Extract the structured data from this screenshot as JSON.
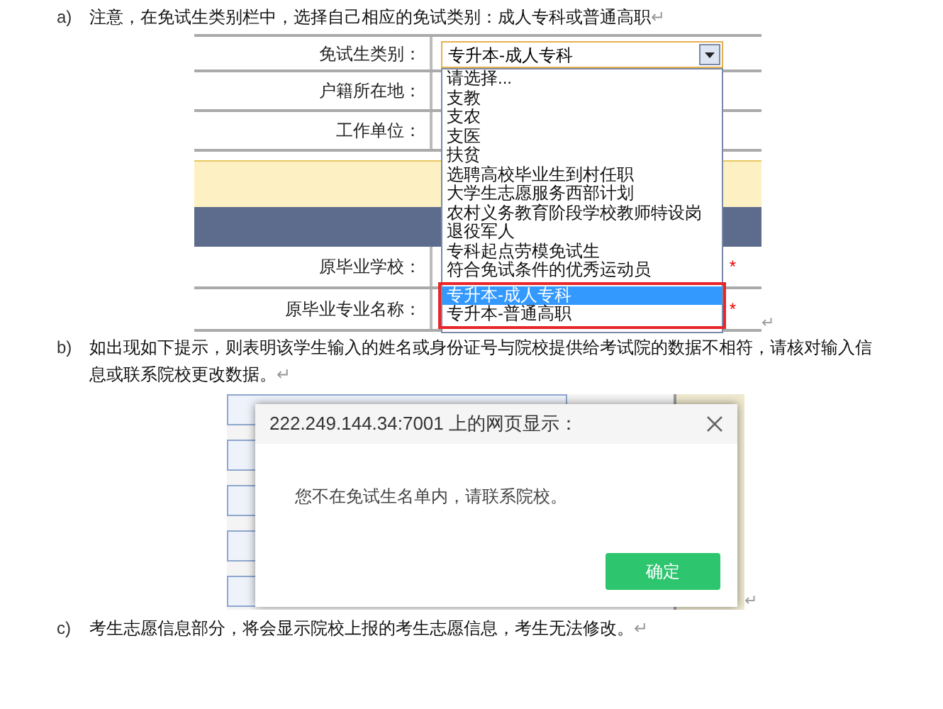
{
  "items": [
    {
      "marker": "a)",
      "text": "注意，在免试生类别栏中，选择自己相应的免试类别：成人专科或普通高职",
      "mark": "↵"
    },
    {
      "marker": "b)",
      "text": "如出现如下提示，则表明该学生输入的姓名或身份证号与院校提供给考试院的数据不相符，请核对输入信息或联系院校更改数据。",
      "mark": "↵"
    },
    {
      "marker": "c)",
      "text": "考生志愿信息部分，将会显示院校上报的考生志愿信息，考生无法修改。",
      "mark": "↵"
    }
  ],
  "form_screenshot": {
    "rows": [
      {
        "kind": "field",
        "label": "免试生类别："
      },
      {
        "kind": "field",
        "label": "户籍所在地："
      },
      {
        "kind": "field",
        "label": "工作单位："
      },
      {
        "kind": "notice_band"
      },
      {
        "kind": "header_band"
      },
      {
        "kind": "field",
        "label": "原毕业学校：",
        "required": "*"
      },
      {
        "kind": "field",
        "label": "原毕业专业名称：",
        "required": "*"
      }
    ],
    "select": {
      "value": "专升本-成人专科",
      "options": [
        {
          "label": "请选择...",
          "selected": false
        },
        {
          "label": "支教",
          "selected": false
        },
        {
          "label": "支农",
          "selected": false
        },
        {
          "label": "支医",
          "selected": false
        },
        {
          "label": "扶贫",
          "selected": false
        },
        {
          "label": "选聘高校毕业生到村任职",
          "selected": false
        },
        {
          "label": "大学生志愿服务西部计划",
          "selected": false
        },
        {
          "label": "农村义务教育阶段学校教师特设岗",
          "selected": false
        },
        {
          "label": "退役军人",
          "selected": false
        },
        {
          "label": "专科起点劳模免试生",
          "selected": false
        },
        {
          "label": "符合免试条件的优秀运动员",
          "selected": false
        }
      ],
      "outlined_options": [
        {
          "label": "专升本-成人专科",
          "selected": true
        },
        {
          "label": "专升本-普通高职",
          "selected": false
        }
      ]
    },
    "mark": "↵"
  },
  "dialog_screenshot": {
    "title": "222.249.144.34:7001 上的网页显示：",
    "message": "您不在免试生名单内，请联系院校。",
    "button": "确定",
    "mark": "↵"
  }
}
